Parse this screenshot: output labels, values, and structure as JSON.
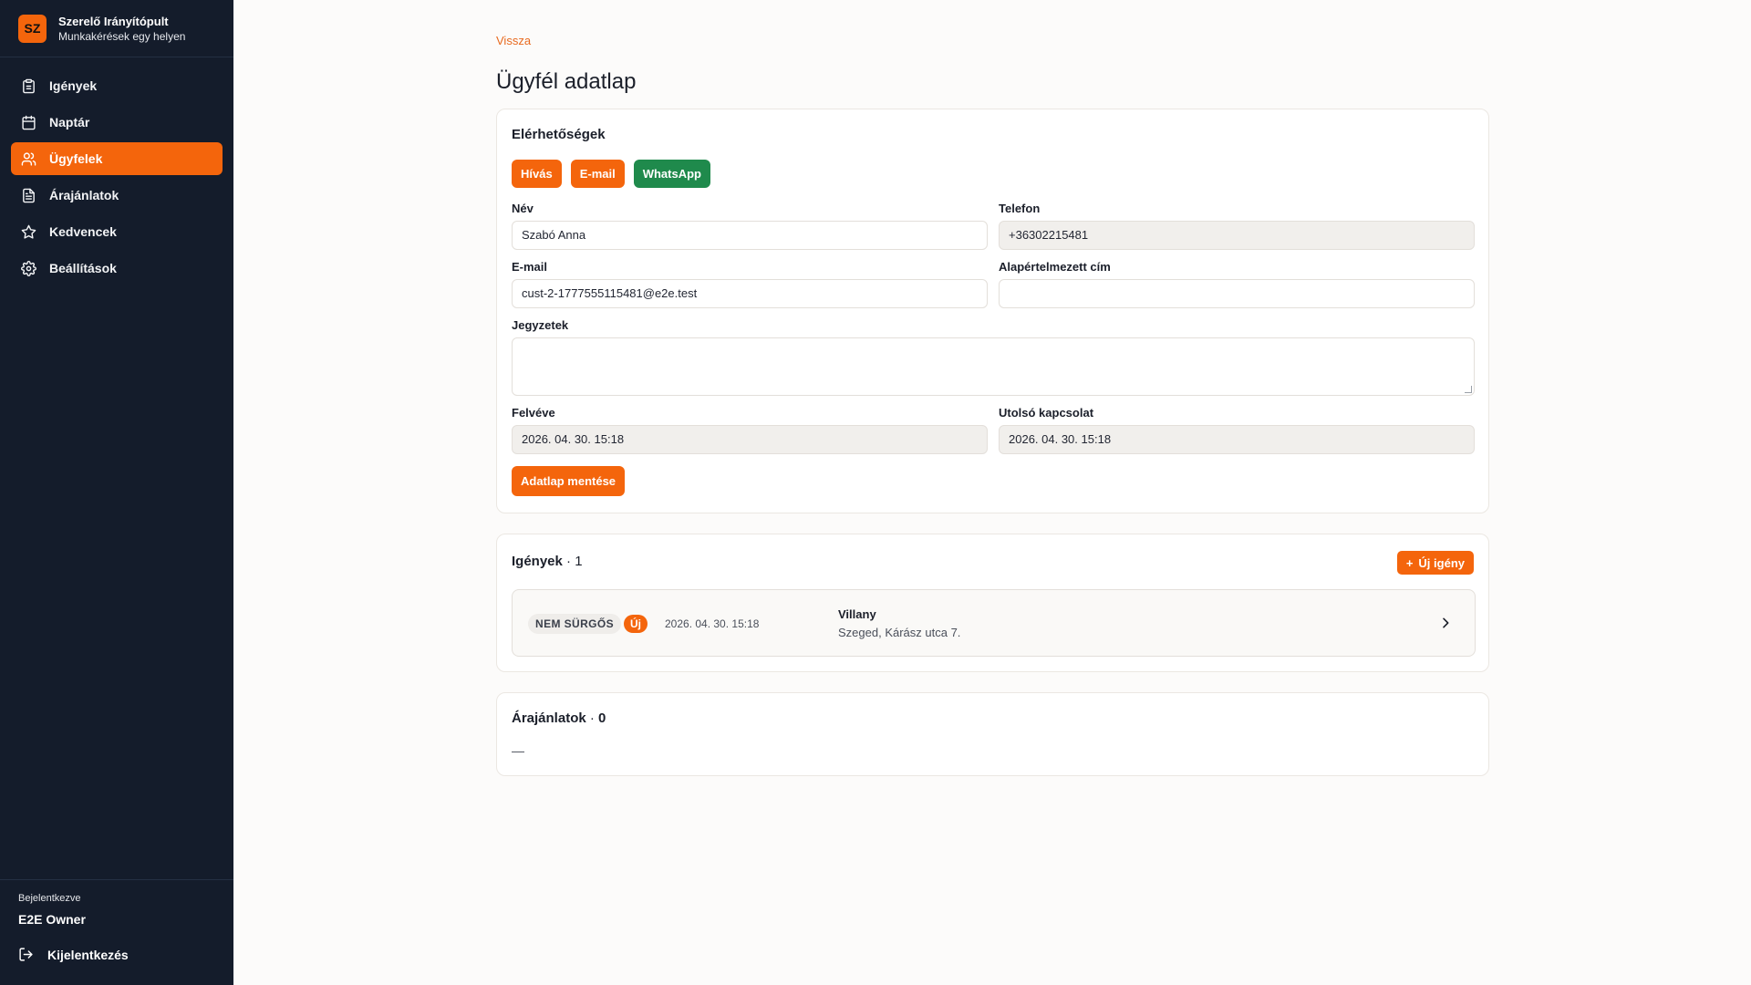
{
  "brand": {
    "logo": "SZ",
    "title": "Szerelő Irányítópult",
    "subtitle": "Munkakérések egy helyen"
  },
  "nav": [
    {
      "label": "Igények",
      "icon": "clipboard-icon",
      "active": false
    },
    {
      "label": "Naptár",
      "icon": "calendar-icon",
      "active": false
    },
    {
      "label": "Ügyfelek",
      "icon": "users-icon",
      "active": true
    },
    {
      "label": "Árajánlatok",
      "icon": "document-icon",
      "active": false
    },
    {
      "label": "Kedvencek",
      "icon": "star-icon",
      "active": false
    },
    {
      "label": "Beállítások",
      "icon": "gear-icon",
      "active": false
    }
  ],
  "footer": {
    "logged_in_label": "Bejelentkezve",
    "user": "E2E Owner",
    "logout": "Kijelentkezés"
  },
  "page": {
    "back": "Vissza",
    "title": "Ügyfél adatlap"
  },
  "contact": {
    "title": "Elérhetőségek",
    "buttons": {
      "call": "Hívás",
      "email": "E-mail",
      "whatsapp": "WhatsApp"
    },
    "fields": {
      "name_label": "Név",
      "name_value": "Szabó Anna",
      "phone_label": "Telefon",
      "phone_value": "+36302215481",
      "email_label": "E-mail",
      "email_value": "cust-2-1777555115481@e2e.test",
      "address_label": "Alapértelmezett cím",
      "address_value": "",
      "notes_label": "Jegyzetek",
      "notes_value": "",
      "created_label": "Felvéve",
      "created_value": "2026. 04. 30. 15:18",
      "last_contact_label": "Utolsó kapcsolat",
      "last_contact_value": "2026. 04. 30. 15:18"
    },
    "save": "Adatlap mentése"
  },
  "requests": {
    "title": "Igények",
    "count": "1",
    "new_button": "Új igény",
    "items": [
      {
        "priority": "NEM SÜRGŐS",
        "status": "Új",
        "date": "2026. 04. 30. 15:18",
        "category": "Villany",
        "address": "Szeged, Kárász utca 7."
      }
    ]
  },
  "quotes": {
    "title": "Árajánlatok",
    "count": "0",
    "empty": "—"
  },
  "colors": {
    "accent": "#f4650c",
    "sidebar": "#141c2b",
    "whatsapp": "#1f8a4c"
  }
}
